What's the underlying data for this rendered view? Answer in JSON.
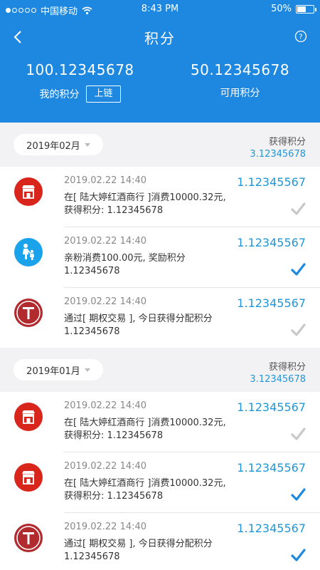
{
  "status_bar": {
    "carrier": "中国移动",
    "time": "8:43 PM",
    "battery": "50%",
    "battery_level": 0.5
  },
  "nav": {
    "title": "积分"
  },
  "summary": {
    "my_points_value": "100.12345678",
    "my_points_label": "我的积分",
    "chain_button": "上链",
    "available_value": "50.12345678",
    "available_label": "可用积分"
  },
  "sections": [
    {
      "month": "2019年02月",
      "earned_label": "获得积分",
      "earned_value": "3.12345678",
      "items": [
        {
          "icon": "shop-icon",
          "date": "2019.02.22  14:40",
          "amount": "1.12345567",
          "desc_line1": "在[ 陆大婷红酒商行 ]消费10000.32元,",
          "desc_line2": "获得积分: 1.12345678",
          "checked": false
        },
        {
          "icon": "family-icon",
          "date": "2019.02.22  14:40",
          "amount": "1.12345567",
          "desc_line1": "亲粉消费100.00元, 奖励积分",
          "desc_line2": "1.12345678",
          "checked": true
        },
        {
          "icon": "t-letter-icon",
          "date": "2019.02.22  14:40",
          "amount": "1.12345567",
          "desc_line1": "通过[ 期权交易 ], 今日获得分配积分",
          "desc_line2": "1.12345678",
          "checked": false
        }
      ]
    },
    {
      "month": "2019年01月",
      "earned_label": "获得积分",
      "earned_value": "3.12345678",
      "items": [
        {
          "icon": "shop-icon",
          "date": "2019.02.22  14:40",
          "amount": "1.12345567",
          "desc_line1": "在[ 陆大婷红酒商行 ]消费10000.32元,",
          "desc_line2": "获得积分: 1.12345678",
          "checked": false
        },
        {
          "icon": "shop-icon",
          "date": "2019.02.22  14:40",
          "amount": "1.12345567",
          "desc_line1": "在[ 陆大婷红酒商行 ]消费10000.32元,",
          "desc_line2": "获得积分: 1.12345678",
          "checked": true
        },
        {
          "icon": "t-letter-icon",
          "date": "2019.02.22  14:40",
          "amount": "1.12345567",
          "desc_line1": "通过[ 期权交易 ], 今日获得分配积分",
          "desc_line2": "1.12345678",
          "checked": true
        }
      ]
    }
  ],
  "colors": {
    "header": "#1e88e0",
    "accent": "#2196d8",
    "shop_red": "#d8261c",
    "family_blue": "#1aa3ea",
    "t_red": "#b02a2e",
    "check_on": "#1e88e0",
    "check_off": "#c8c8c8"
  }
}
